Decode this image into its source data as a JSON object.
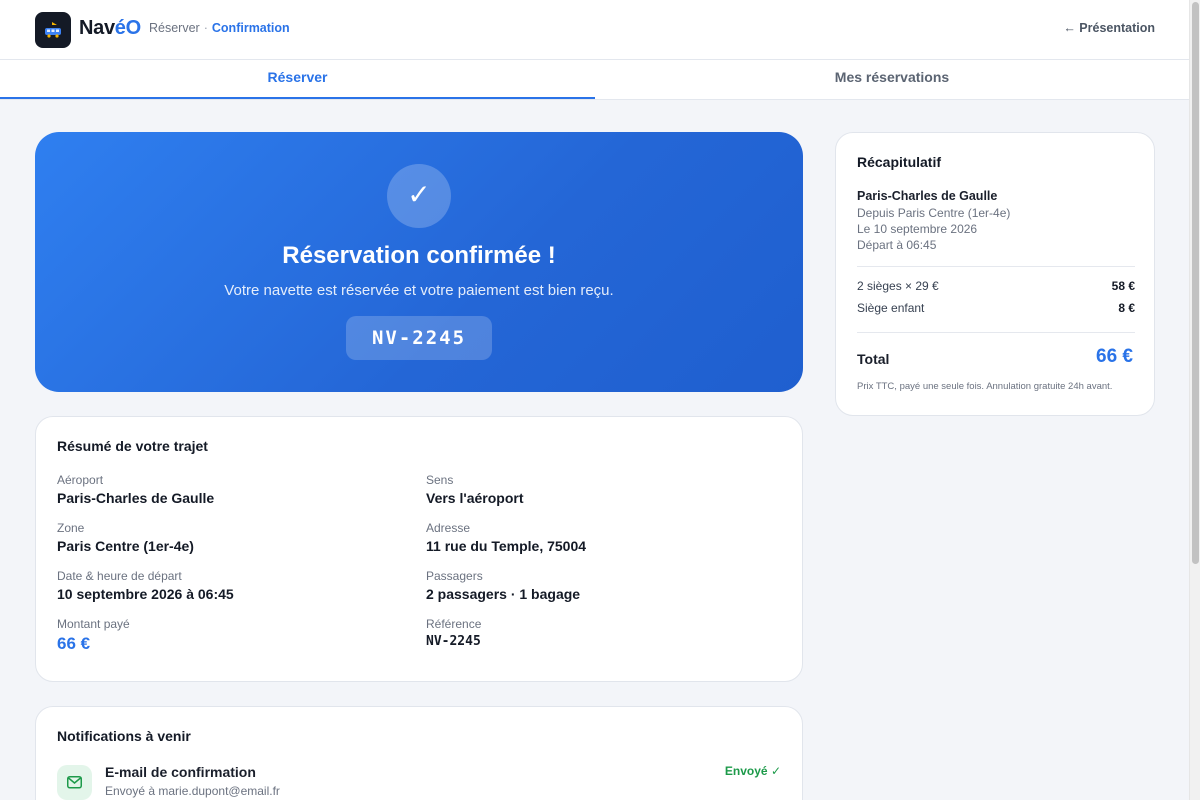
{
  "header": {
    "brand_main": "Nav",
    "brand_accent": "éO",
    "breadcrumb_parent": "Réserver",
    "breadcrumb_sep": "·",
    "breadcrumb_current": "Confirmation",
    "back_label": "← Présentation",
    "logo_icon": "shuttle-icon"
  },
  "tabs": [
    {
      "label": "Réserver",
      "active": true
    },
    {
      "label": "Mes réservations",
      "active": false
    }
  ],
  "hero": {
    "check": "✓",
    "title": "Réservation confirmée !",
    "subtitle": "Votre navette est réservée et votre paiement est bien reçu.",
    "reference": "NV-2245"
  },
  "summary": {
    "title": "Résumé de votre trajet",
    "fields": [
      {
        "label": "Aéroport",
        "value": "Paris-Charles de Gaulle"
      },
      {
        "label": "Sens",
        "value": "Vers l'aéroport"
      },
      {
        "label": "Zone",
        "value": "Paris Centre (1er-4e)"
      },
      {
        "label": "Adresse",
        "value": "11 rue du Temple, 75004"
      },
      {
        "label": "Date & heure de départ",
        "value": "10 septembre 2026 à 06:45"
      },
      {
        "label": "Passagers",
        "value": "2 passagers · 1 bagage"
      },
      {
        "label": "Montant payé",
        "value": "66 €"
      },
      {
        "label": "Référence",
        "value": "NV-2245"
      }
    ]
  },
  "notifications": {
    "title": "Notifications à venir",
    "items": [
      {
        "name": "E-mail de confirmation",
        "detail": "Envoyé à marie.dupont@email.fr",
        "status": "Envoyé ✓",
        "icon": "mail-icon"
      }
    ]
  },
  "recap": {
    "title": "Récapitulatif",
    "destination": "Paris-Charles de Gaulle",
    "lines": [
      "Depuis Paris Centre (1er-4e)",
      "Le 10 septembre 2026",
      "Départ à 06:45"
    ],
    "rows": [
      {
        "label": "2 sièges × 29 €",
        "amount": "58 €"
      },
      {
        "label": "Siège enfant",
        "amount": "8 €"
      }
    ],
    "total_label": "Total",
    "total_value": "66 €",
    "note": "Prix TTC, payé une seule fois. Annulation gratuite 24h avant."
  },
  "colors": {
    "accent": "#2a73e8",
    "success": "#1d9a4a",
    "dark": "#141a26"
  }
}
